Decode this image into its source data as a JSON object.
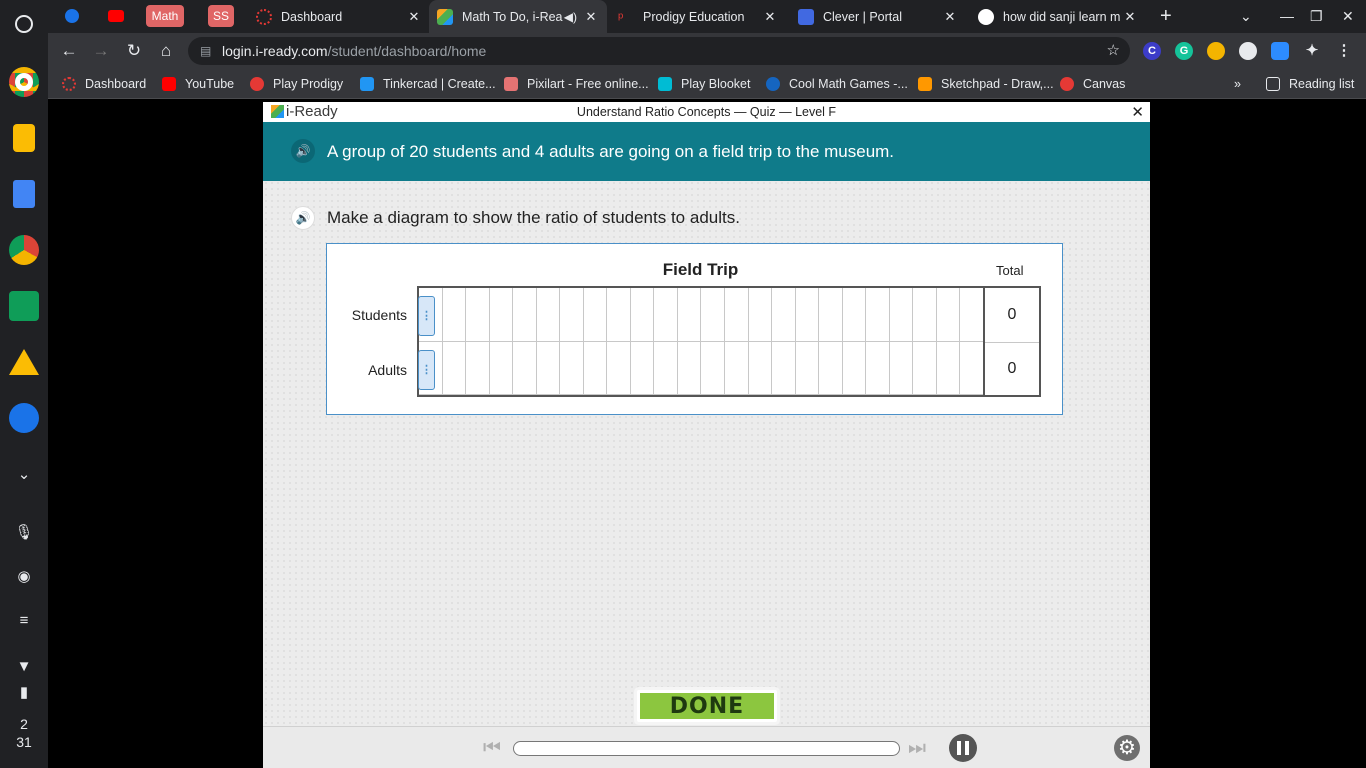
{
  "tabs": {
    "pinned": [
      {
        "label": "",
        "color": "#1a73e8"
      },
      {
        "label": "",
        "color": "#ff0000"
      },
      {
        "label": "Math",
        "color": "#e06666"
      },
      {
        "label": "SS",
        "color": "#e06666"
      }
    ],
    "items": [
      {
        "title": "Dashboard",
        "favicon_color": "#e53935"
      },
      {
        "title": "Math To Do, i-Rea",
        "favicon_color": "#f5a623"
      },
      {
        "title": "Prodigy Education",
        "favicon_color": "#e53935"
      },
      {
        "title": "Clever | Portal",
        "favicon_color": "#4169e1"
      },
      {
        "title": "how did sanji learn m",
        "favicon_color": "#ffffff"
      }
    ],
    "new_tab": "+"
  },
  "toolbar": {
    "url_domain": "login.i-ready.com",
    "url_path": "/student/dashboard/home"
  },
  "bookmarks": [
    {
      "label": "Dashboard",
      "color": "#e53935"
    },
    {
      "label": "YouTube",
      "color": "#ff0000"
    },
    {
      "label": "Play Prodigy",
      "color": "#e53935"
    },
    {
      "label": "Tinkercad | Create...",
      "color": "#2196f3"
    },
    {
      "label": "Pixilart - Free online...",
      "color": "#e57373"
    },
    {
      "label": "Play Blooket",
      "color": "#00bcd4"
    },
    {
      "label": "Cool Math Games -...",
      "color": "#1565c0"
    },
    {
      "label": "Sketchpad - Draw,...",
      "color": "#ff9800"
    },
    {
      "label": "Canvas",
      "color": "#e53935"
    }
  ],
  "reading_list": "Reading list",
  "app": {
    "logo": "i-Ready",
    "lesson_title": "Understand Ratio Concepts — Quiz — Level F",
    "prompt": "A group of 20 students and 4 adults are going on a field trip to the museum.",
    "instruction": "Make a diagram to show the ratio of students to adults.",
    "diagram": {
      "title": "Field Trip",
      "total_label": "Total",
      "rows": [
        {
          "label": "Students",
          "total": "0"
        },
        {
          "label": "Adults",
          "total": "0"
        }
      ]
    },
    "done_label": "DONE"
  },
  "shelf": {
    "clock_hour": "2",
    "clock_min": "31"
  }
}
